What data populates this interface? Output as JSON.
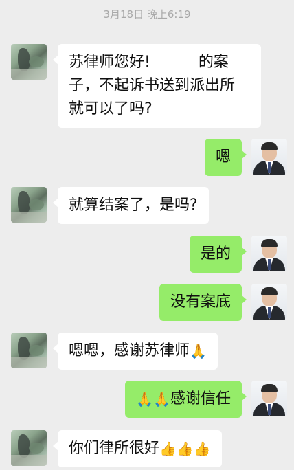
{
  "timestamp": "3月18日 晚上6:19",
  "messages": [
    {
      "side": "left",
      "line1_a": "苏律师您好!",
      "line1_b": "的案",
      "line2": "子，不起诉书送到派出所",
      "line3": "就可以了吗?"
    },
    {
      "side": "right",
      "text": "嗯"
    },
    {
      "side": "left",
      "text": "就算结案了，是吗?"
    },
    {
      "side": "right",
      "text": "是的"
    },
    {
      "side": "right",
      "text": "没有案底"
    },
    {
      "side": "left",
      "text": "嗯嗯，感谢苏律师",
      "emoji": "🙏"
    },
    {
      "side": "right",
      "emoji": "🙏🙏",
      "text": "感谢信任"
    },
    {
      "side": "left",
      "text": "你们律所很好",
      "emoji": "👍👍👍"
    }
  ],
  "icons": {
    "contact_avatar": "contact-avatar",
    "self_avatar": "lawyer-avatar"
  },
  "colors": {
    "background": "#ededed",
    "bubble_left": "#ffffff",
    "bubble_right": "#95ec69",
    "timestamp": "#a8a8a8"
  }
}
